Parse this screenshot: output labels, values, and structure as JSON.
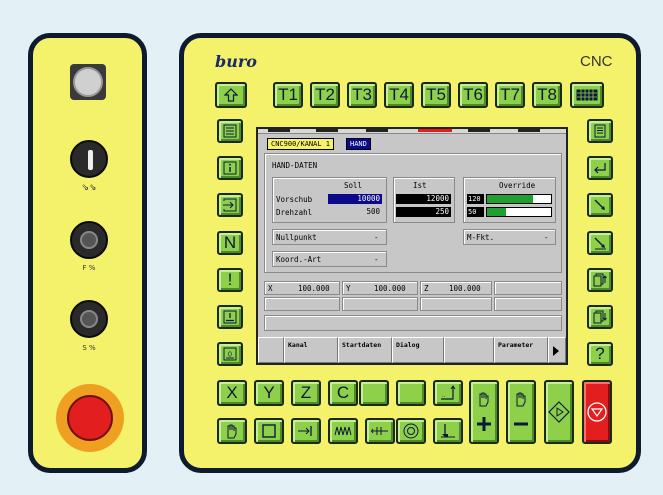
{
  "brand": {
    "logo": "buro",
    "model": "CNC"
  },
  "top_row": {
    "home_icon": "arrow-up-icon",
    "tools": [
      "T1",
      "T2",
      "T3",
      "T4",
      "T5",
      "T6",
      "T7",
      "T8"
    ],
    "keyboard_icon": "keyboard-icon"
  },
  "left_side_icons": [
    "list-icon",
    "info-icon",
    "arrow-right-icon",
    "n-key",
    "exclamation-icon",
    "underline-box-icon",
    "zero-key-icon"
  ],
  "left_side_n_label": "N",
  "left_side_excl_label": "!",
  "right_side": {
    "help_label": "?"
  },
  "axis_keys": [
    "X",
    "Y",
    "Z",
    "C"
  ],
  "left_panel": {
    "f_label": "F %",
    "s_label": "S %"
  },
  "screen": {
    "channel_label": "CNC900/KANAL 1",
    "mode_label": "HAND",
    "section_title": "HAND-DATEN",
    "soll_header": "Soll",
    "ist_header": "Ist",
    "override_header": "Override",
    "vorschub_label": "Vorschub",
    "vorschub_soll": "10000",
    "vorschub_ist": "12000",
    "drehzahl_label": "Drehzahl",
    "drehzahl_soll": "500",
    "drehzahl_ist": "250",
    "override_feed": "120",
    "override_feed_level": 0.72,
    "override_spindle": "50",
    "override_spindle_level": 0.3,
    "nullpunkt_label": "Nullpunkt",
    "nullpunkt_value": "-",
    "mfkt_label": "M-Fkt.",
    "mfkt_value": "-",
    "koord_label": "Koord.-Art",
    "koord_value": "-",
    "pos_x_label": "X",
    "pos_x_value": "100.000",
    "pos_y_label": "Y",
    "pos_y_value": "100.000",
    "pos_z_label": "Z",
    "pos_z_value": "100.000",
    "softkeys": [
      "Kanal",
      "Startdaten",
      "Dialog",
      "",
      "Parameter"
    ]
  },
  "colors": {
    "panel": "#f4f26a",
    "button": "#8ed04a",
    "selected": "#0a0a8a",
    "stop": "#e02020"
  }
}
